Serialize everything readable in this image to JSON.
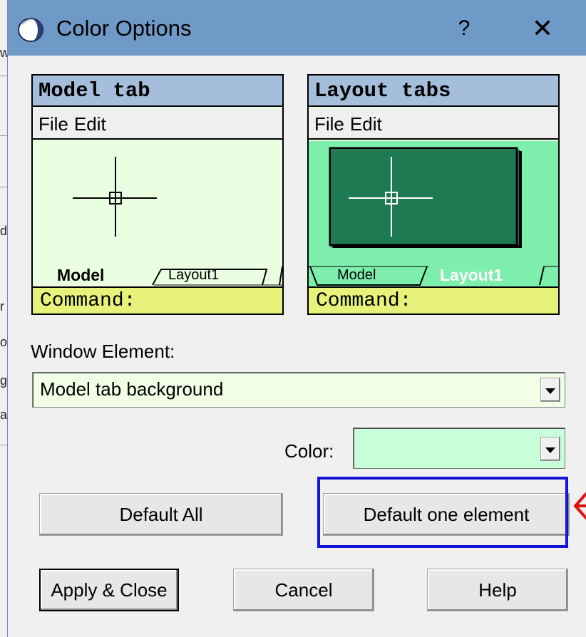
{
  "dialog": {
    "title": "Color Options",
    "help_glyph": "?",
    "close_glyph": "✕"
  },
  "background_app": {
    "fragments": [
      "w",
      "d",
      "r",
      "o",
      "g",
      "a"
    ]
  },
  "model_preview": {
    "header": "Model tab",
    "menu": [
      "File",
      "Edit"
    ],
    "tabs": [
      "Model",
      "Layout1"
    ],
    "command": "Command:",
    "background_color": "#eaffe2"
  },
  "layout_preview": {
    "header": "Layout tabs",
    "menu": [
      "File",
      "Edit"
    ],
    "tabs": [
      "Model",
      "Layout1"
    ],
    "command": "Command:",
    "background_color": "#7deeac"
  },
  "window_element": {
    "label": "Window Element:",
    "value": "Model tab background"
  },
  "color": {
    "label": "Color:",
    "swatch": "#c9ffd8"
  },
  "buttons": {
    "default_all": "Default All",
    "default_one": "Default one element",
    "apply_close": "Apply & Close",
    "cancel": "Cancel",
    "help": "Help"
  },
  "annotation": {
    "highlight_color": "#1414d8",
    "arrow_color": "#e01010"
  }
}
